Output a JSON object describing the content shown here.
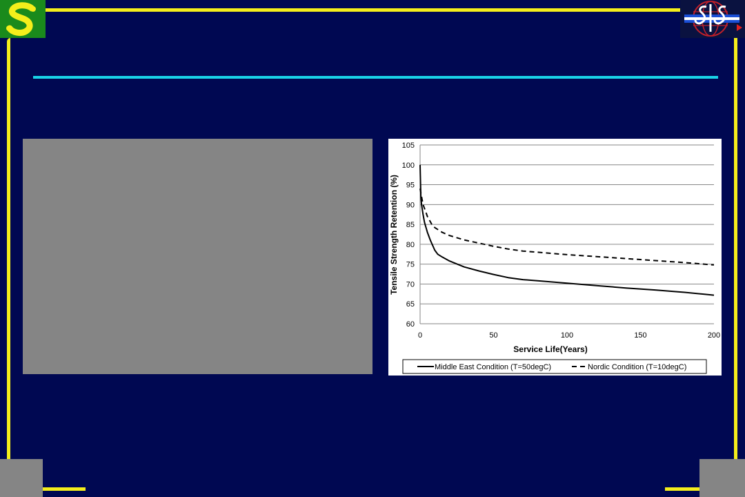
{
  "colors": {
    "background": "#000852",
    "frame": "#f5ee1b",
    "title_rule": "#19d3e8",
    "placeholder": "#858585",
    "logo_left_bg": "#1a8a1c",
    "logo_left_glyph": "#f5ee1b"
  },
  "logos": {
    "left_icon": "stylized-s-logo-icon",
    "right_icon": "sis-globe-logo-icon"
  },
  "chart_data": {
    "type": "line",
    "title": "",
    "xlabel": "Service Life(Years)",
    "ylabel": "Tensile Strength Retention (%)",
    "xlim": [
      0,
      200
    ],
    "ylim": [
      60,
      105
    ],
    "x_ticks": [
      "0",
      "50",
      "100",
      "150",
      "200"
    ],
    "y_ticks": [
      "60",
      "65",
      "70",
      "75",
      "80",
      "85",
      "90",
      "95",
      "100",
      "105"
    ],
    "grid": "horizontal",
    "legend_position": "bottom",
    "series": [
      {
        "name": "Middle East Condition (T=50degC)",
        "style": "solid",
        "x": [
          0,
          0.5,
          1,
          2,
          3,
          5,
          7,
          10,
          12,
          15,
          20,
          30,
          40,
          50,
          60,
          70,
          80,
          100,
          120,
          140,
          160,
          180,
          200
        ],
        "y": [
          100,
          92,
          90,
          87.5,
          85.5,
          83,
          81,
          78.5,
          77.5,
          76.8,
          75.8,
          74.3,
          73.3,
          72.4,
          71.6,
          71.1,
          70.8,
          70.2,
          69.6,
          69.0,
          68.5,
          67.9,
          67.2
        ]
      },
      {
        "name": "Nordic Condition (T=10degC)",
        "style": "dashed",
        "x": [
          0,
          1,
          2,
          5,
          8,
          10,
          15,
          20,
          30,
          40,
          50,
          60,
          70,
          80,
          100,
          120,
          140,
          160,
          180,
          200
        ],
        "y": [
          94,
          92,
          90,
          87,
          85,
          84.2,
          83,
          82.2,
          81.1,
          80.3,
          79.5,
          78.8,
          78.3,
          78.0,
          77.4,
          76.9,
          76.4,
          75.9,
          75.4,
          74.8
        ]
      }
    ]
  }
}
